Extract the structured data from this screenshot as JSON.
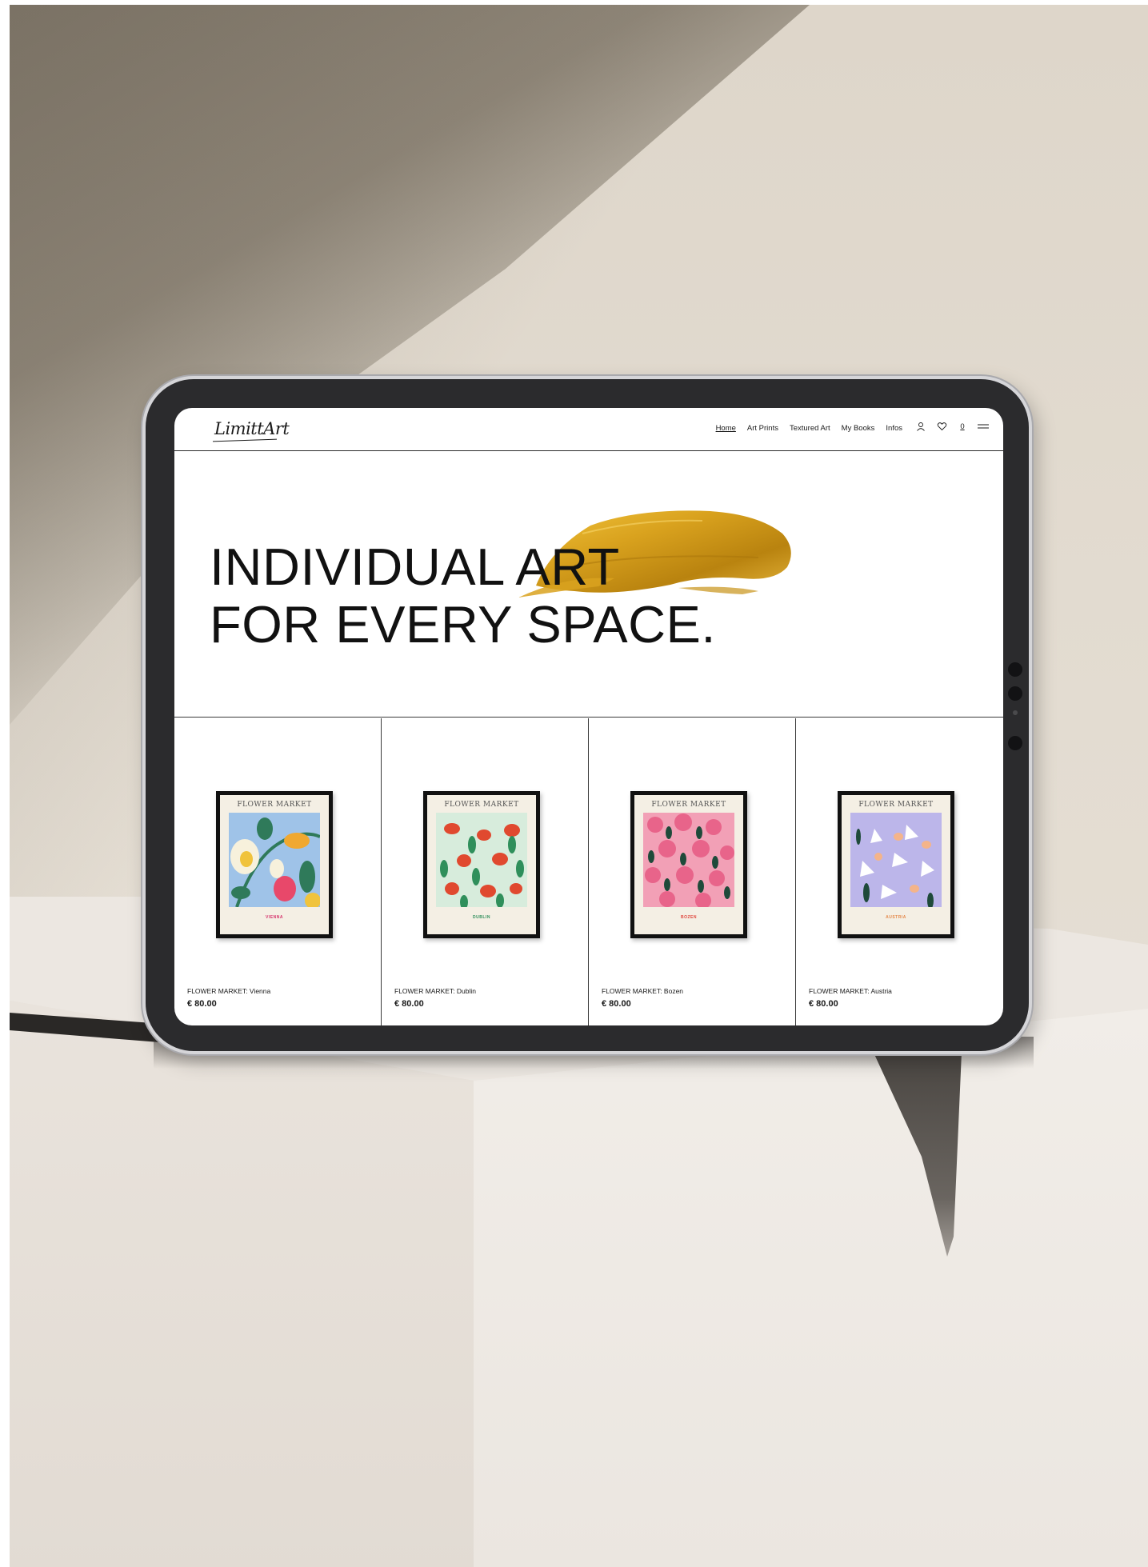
{
  "brand": {
    "logo_text": "LimittArt"
  },
  "nav": {
    "items": [
      {
        "label": "Home",
        "active": true
      },
      {
        "label": "Art Prints",
        "active": false
      },
      {
        "label": "Textured Art",
        "active": false
      },
      {
        "label": "My Books",
        "active": false
      },
      {
        "label": "Infos",
        "active": false
      }
    ],
    "icons": [
      "user-icon",
      "heart-icon",
      "cart-icon",
      "menu-icon"
    ],
    "cart_count": "0"
  },
  "hero": {
    "line1": "INDIVIDUAL ART",
    "line2": "FOR EVERY SPACE.",
    "accent_color": "#c8961a"
  },
  "products": [
    {
      "name": "FLOWER MARKET: Vienna",
      "price": "€ 80.00",
      "poster_title": "FLOWER MARKET",
      "poster_city": "VIENNA",
      "city_color": "#d6336c",
      "bg": "#9fc3e8"
    },
    {
      "name": "FLOWER MARKET: Dublin",
      "price": "€ 80.00",
      "poster_title": "FLOWER MARKET",
      "poster_city": "DUBLIN",
      "city_color": "#2f8f5b",
      "bg": "#d7ecdc"
    },
    {
      "name": "FLOWER MARKET: Bozen",
      "price": "€ 80.00",
      "poster_title": "FLOWER MARKET",
      "poster_city": "BOZEN",
      "city_color": "#e0483f",
      "bg": "#f2a0b6"
    },
    {
      "name": "FLOWER MARKET: Austria",
      "price": "€ 80.00",
      "poster_title": "FLOWER MARKET",
      "poster_city": "AUSTRIA",
      "city_color": "#e58a4c",
      "bg": "#bcb6ea"
    }
  ]
}
